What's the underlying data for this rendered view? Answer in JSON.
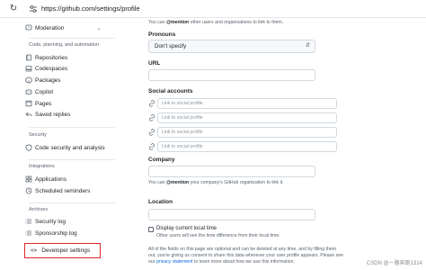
{
  "browser": {
    "url": "https://github.com/settings/profile"
  },
  "sidebar": {
    "top_item": "Moderation",
    "groups": {
      "code": "Code, planning, and automation",
      "security": "Security",
      "integrations": "Integrations",
      "archives": "Archives"
    },
    "items": [
      {
        "label": "Repositories",
        "icon": "repo-icon"
      },
      {
        "label": "Codespaces",
        "icon": "codespaces-icon"
      },
      {
        "label": "Packages",
        "icon": "package-icon"
      },
      {
        "label": "Copilot",
        "icon": "copilot-icon"
      },
      {
        "label": "Pages",
        "icon": "browser-icon"
      },
      {
        "label": "Saved replies",
        "icon": "reply-icon"
      },
      {
        "label": "Code security and analysis",
        "icon": "shield-lock-icon"
      },
      {
        "label": "Applications",
        "icon": "apps-icon"
      },
      {
        "label": "Scheduled reminders",
        "icon": "clock-icon"
      },
      {
        "label": "Security log",
        "icon": "log-icon"
      },
      {
        "label": "Sponsorship log",
        "icon": "log-icon"
      }
    ],
    "developer_settings": {
      "label": "Developer settings",
      "icon": "code-icon",
      "icon_glyph": "<>"
    }
  },
  "main": {
    "mention_note": {
      "prefix": "You can ",
      "bold": "@mention",
      "suffix": " other users and organizations to link to them."
    },
    "pronouns": {
      "label": "Pronouns",
      "value": "Don't specify"
    },
    "url": {
      "label": "URL",
      "value": ""
    },
    "social": {
      "label": "Social accounts",
      "placeholder": "Link to social profile"
    },
    "company": {
      "label": "Company",
      "note_prefix": "You can ",
      "note_bold": "@mention",
      "note_suffix": " your company's GitHub organization to link it."
    },
    "location": {
      "label": "Location",
      "value": ""
    },
    "local_time": {
      "label": "Display current local time",
      "note": "Other users will see the time difference from their local time."
    },
    "footer": {
      "line1": "All of the fields on this page are optional and can be deleted at any time, and by filling them",
      "line2": "out, you're giving us consent to share this data wherever your user profile appears. Please see",
      "line3_prefix": "our ",
      "line3_link": "privacy statement",
      "line3_suffix": " to learn more about how we use this information."
    }
  },
  "watermark": "CSDN @一路奔跑1314",
  "colors": {
    "accent": "#0969da",
    "highlight_border": "#e0262a",
    "text": "#1f2328",
    "muted": "#59636e"
  }
}
